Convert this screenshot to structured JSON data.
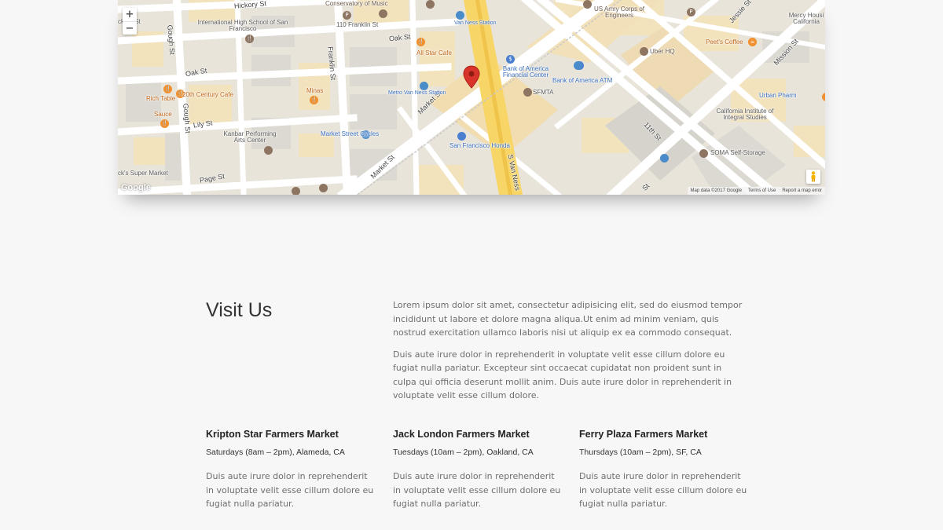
{
  "map": {
    "zoom_in_label": "+",
    "zoom_out_label": "−",
    "google_logo": "Google",
    "attribution": {
      "map_data": "Map data ©2017 Google",
      "terms": "Terms of Use",
      "report": "Report a map error"
    },
    "marker_color": "#d9342b",
    "streets": {
      "hickory_st": "Hickory St",
      "oak_st_left": "Oak St",
      "oak_st_center": "Oak St",
      "lily_st": "Lily St",
      "page_st": "Page St",
      "gough_st_top": "Gough St",
      "gough_st_bottom": "Gough St",
      "franklin_st": "Franklin St",
      "market_st_upper": "Market St",
      "market_st_lower": "Market St",
      "s_van_ness": "S Van Ness",
      "eleventh_st": "11th St",
      "jessie_st": "Jessie St",
      "mission_st": "Mission St",
      "bottom_st": "St"
    },
    "places": {
      "skory_st": "ckory St",
      "international_high_school": "International High School of San Francisco",
      "conservatory_of_music": "Conservatory of Music",
      "franklin_110": "110 Franklin St",
      "van_ness_station_top": "Van Ness Station",
      "us_army_corps": "US Army Corps of Engineers",
      "mercy_housing": "Mercy Housi California",
      "peets_coffee": "Peet's Coffee",
      "uber_hq": "Uber HQ",
      "all_star_cafe": "All Star Cafe",
      "bank_of_america_fc": "Bank of America Financial Center",
      "bank_of_america_atm": "Bank of America ATM",
      "sfmta": "SFMTA",
      "metro_van_ness": "Metro Van Ness Station",
      "urban_pharm": "Urban Pharm",
      "california_institute": "California Institute of Integral Studies",
      "rich_table": "Rich Table",
      "twentieth_century_cafe": "20th Century Cafe",
      "minas": "Minas",
      "sauce": "Sauce",
      "kanbar": "Kanbar Performing Arts Center",
      "market_street_cycles": "Market Street Cycles",
      "sf_honda": "San Francisco Honda",
      "soma_self_storage": "SOMA Self-Storage",
      "supermarket": "ck's Super Market"
    },
    "poi_icons": {
      "parking": "P",
      "restaurant": "🍴",
      "dollar": "$",
      "bus": "▪",
      "cafe": "☕"
    }
  },
  "visit": {
    "title": "Visit Us",
    "paragraphs": [
      "Lorem ipsum dolor sit amet, consectetur adipisicing elit, sed do eiusmod tempor incididunt ut labore et dolore magna aliqua.Ut enim ad minim veniam, quis nostrud exercitation ullamco laboris nisi ut aliquip ex ea commodo consequat.",
      "Duis aute irure dolor in reprehenderit in voluptate velit esse cillum dolore eu fugiat nulla pariatur. Excepteur sint occaecat cupidatat non proident sunt in culpa qui officia deserunt mollit anim. Duis aute irure dolor in reprehenderit in voluptate velit esse cillum dolore."
    ]
  },
  "markets": [
    {
      "name": "Kripton Star Farmers Market",
      "hours": "Saturdays (8am – 2pm), Alameda, CA",
      "description": "Duis aute irure dolor in reprehenderit in voluptate velit esse cillum dolore eu fugiat nulla pariatur."
    },
    {
      "name": "Jack London Farmers Market",
      "hours": "Tuesdays (10am – 2pm), Oakland, CA",
      "description": "Duis aute irure dolor in reprehenderit in voluptate velit esse cillum dolore eu fugiat nulla pariatur."
    },
    {
      "name": "Ferry Plaza Farmers Market",
      "hours": "Thursdays (10am – 2pm), SF, CA",
      "description": "Duis aute irure dolor in reprehenderit in voluptate velit esse cillum dolore eu fugiat nulla pariatur."
    }
  ]
}
